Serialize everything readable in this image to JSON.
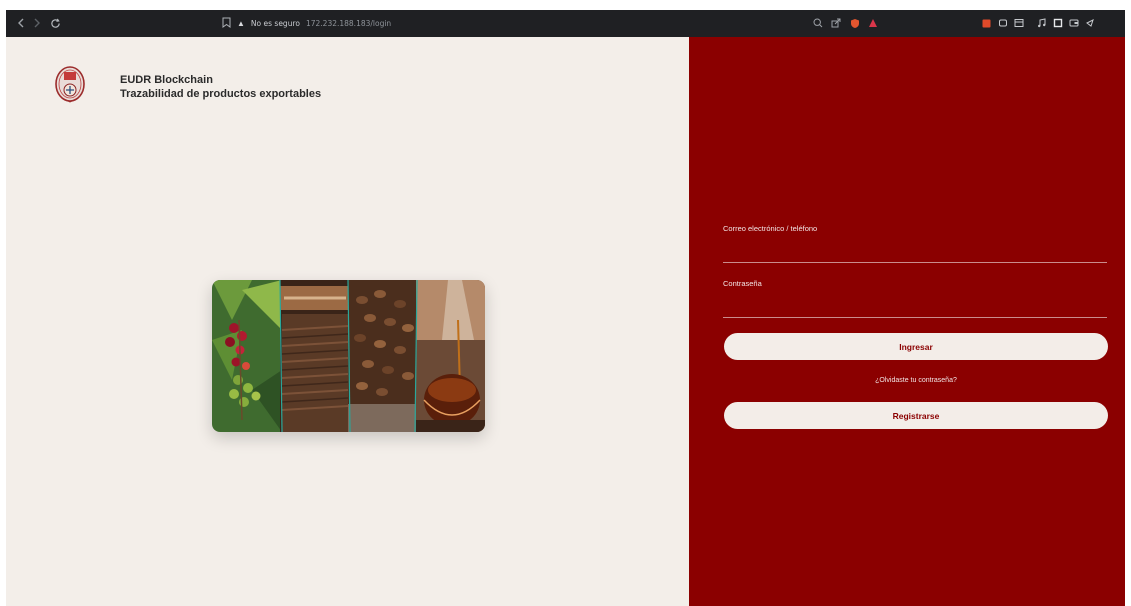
{
  "browser": {
    "back_icon": "chevron-left-icon",
    "forward_icon": "chevron-right-icon",
    "reload_icon": "reload-icon",
    "security_text": "No es seguro",
    "url": "172.232.188.183/login"
  },
  "brand": {
    "title": "EUDR Blockchain",
    "subtitle": "Trazabilidad de productos exportables"
  },
  "login": {
    "email_label": "Correo electrónico / teléfono",
    "password_label": "Contraseña",
    "login_button": "Ingresar",
    "forgot_link": "¿Olvidaste tu contraseña?",
    "register_button": "Registrarse"
  },
  "colors": {
    "left_bg": "#f3eee9",
    "right_bg": "#8b0000",
    "button_bg": "#f3ede8",
    "browser_bg": "#1f2023"
  }
}
